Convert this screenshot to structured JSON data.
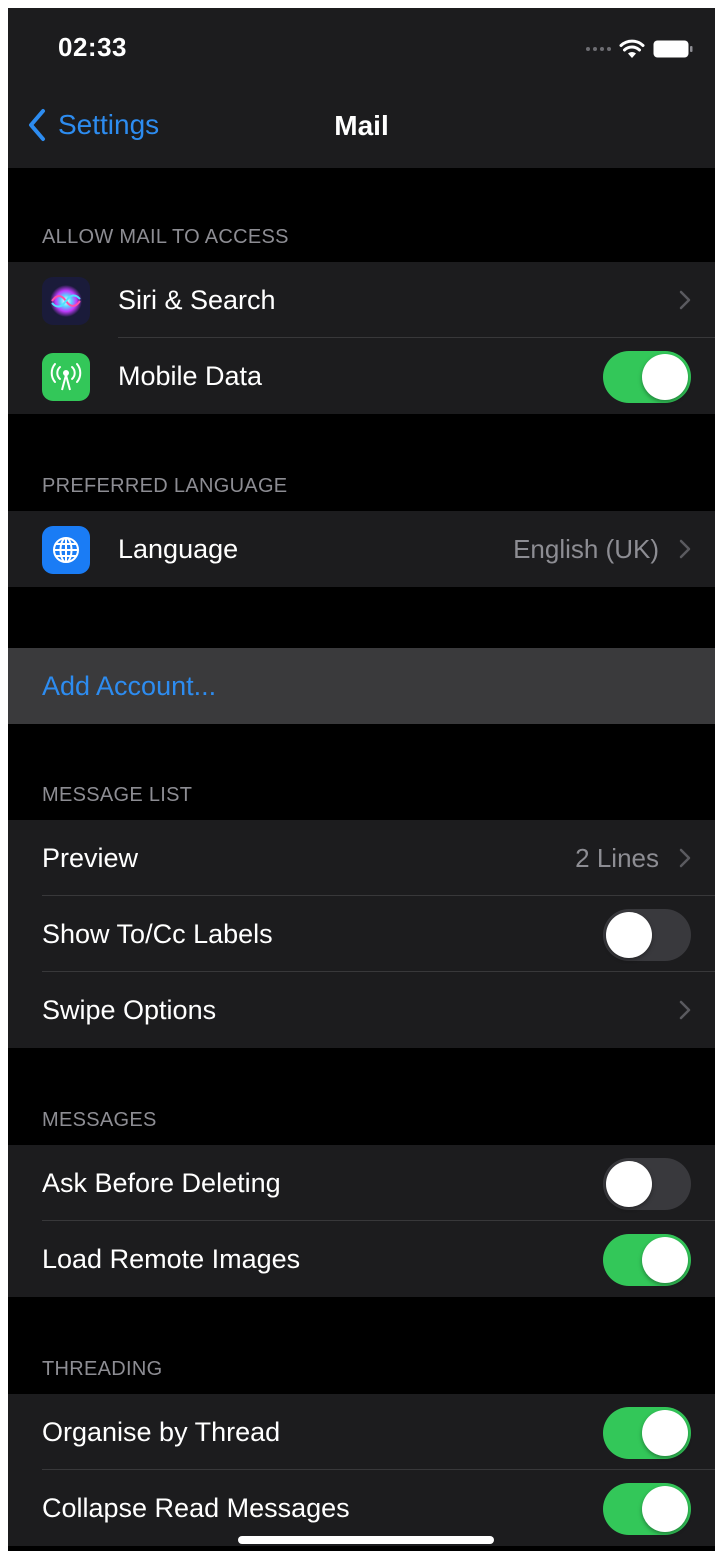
{
  "status_bar": {
    "time": "02:33"
  },
  "nav": {
    "back_label": "Settings",
    "title": "Mail"
  },
  "sections": {
    "allow_access": {
      "header": "ALLOW MAIL TO ACCESS",
      "siri": {
        "label": "Siri & Search",
        "icon": "siri-icon"
      },
      "mobile_data": {
        "label": "Mobile Data",
        "icon": "antenna-icon",
        "on": true
      }
    },
    "preferred_language": {
      "header": "PREFERRED LANGUAGE",
      "language": {
        "label": "Language",
        "value": "English (UK)",
        "icon": "globe-icon"
      }
    },
    "accounts": {
      "add_label": "Add Account..."
    },
    "message_list": {
      "header": "MESSAGE LIST",
      "preview": {
        "label": "Preview",
        "value": "2 Lines"
      },
      "show_tocc": {
        "label": "Show To/Cc Labels",
        "on": false
      },
      "swipe": {
        "label": "Swipe Options"
      }
    },
    "messages": {
      "header": "MESSAGES",
      "ask_delete": {
        "label": "Ask Before Deleting",
        "on": false
      },
      "remote_images": {
        "label": "Load Remote Images",
        "on": true
      }
    },
    "threading": {
      "header": "THREADING",
      "organise": {
        "label": "Organise by Thread",
        "on": true
      },
      "collapse": {
        "label": "Collapse Read Messages",
        "on": true
      }
    }
  },
  "colors": {
    "accent": "#2d8cf0",
    "toggle_on": "#33c759",
    "background": "#000000",
    "cell": "#1c1c1e"
  }
}
